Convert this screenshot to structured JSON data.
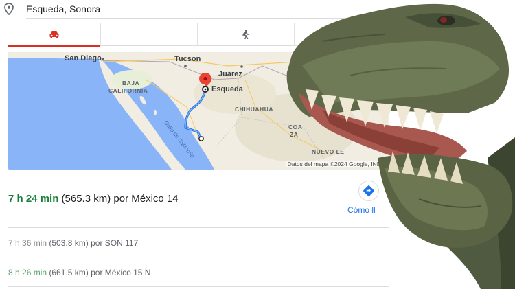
{
  "search": {
    "query": "Esqueda, Sonora",
    "icon": "map-pin-icon"
  },
  "tabs": [
    {
      "name": "driving",
      "icon": "car-icon",
      "active": true
    },
    {
      "name": "transit",
      "icon": "",
      "active": false
    },
    {
      "name": "walking",
      "icon": "walking-icon",
      "active": false
    }
  ],
  "map": {
    "labels": {
      "san_diego": "San Diego",
      "tucson": "Tucson",
      "juarez": "Juárez",
      "esqueda": "Esqueda",
      "baja_1": "BAJA",
      "baja_2": "CALIFORNIA",
      "chihuahua": "CHIHUAHUA",
      "coah_1": "COA",
      "coah_2": "ZA",
      "nuevo": "NUEVO LE",
      "gulf": "Golfo de California"
    },
    "attribution": "Datos del mapa ©2024 Google, INEG",
    "colors": {
      "water": "#8ab4f8",
      "land": "#f1ede3",
      "route": "#4285f4",
      "pin": "#ea4335"
    }
  },
  "routes": {
    "main": {
      "time": "7 h 24 min",
      "distance": "(565.3 km)",
      "via": "por México 14"
    },
    "alt1": {
      "time": "7 h 36 min",
      "distance": "(503.8 km)",
      "via": "por SON 117"
    },
    "alt2": {
      "time": "8 h 26 min",
      "distance": "(661.5 km)",
      "via": "por México 15 N"
    }
  },
  "directions": {
    "label": "Cómo ll"
  }
}
